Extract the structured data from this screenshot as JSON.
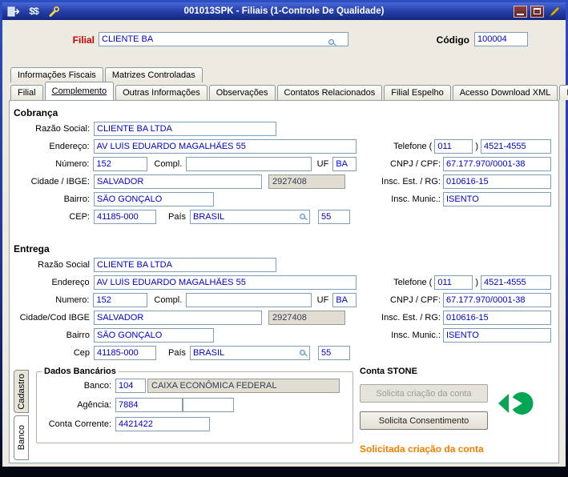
{
  "window": {
    "title": "001013SPK - Filiais (1-Controle De Qualidade)",
    "icons_left": [
      "exit-icon",
      "money-icon",
      "wrench-icon"
    ],
    "money_glyph": "$$",
    "icons_right": [
      "minimize-icon",
      "maximize-icon",
      "edit-pencil-icon"
    ]
  },
  "colors": {
    "filial_label": "#cc0000",
    "status_orange": "#ef7f00",
    "stone_green": "#00a651",
    "input_text": "#0000cc",
    "titlebar_blue": "#2743ae"
  },
  "header": {
    "filial_label": "Filial",
    "filial_value": "CLIENTE BA",
    "codigo_label": "Código",
    "codigo_value": "100004"
  },
  "tabs_top": [
    {
      "label": "Informações Fiscais"
    },
    {
      "label": "Matrizes Controladas"
    }
  ],
  "tabs_main": [
    {
      "label": "Filial"
    },
    {
      "label": "Complemento",
      "active": true
    },
    {
      "label": "Outras Informações"
    },
    {
      "label": "Observações"
    },
    {
      "label": "Contatos Relacionados"
    },
    {
      "label": "Filial Espelho"
    },
    {
      "label": "Acesso Download XML"
    },
    {
      "label": "Log"
    }
  ],
  "cobranca": {
    "title": "Cobrança",
    "labels": {
      "razao": "Razão Social:",
      "endereco": "Endereço:",
      "numero": "Número:",
      "compl": "Compl.",
      "uf": "UF",
      "cidade": "Cidade / IBGE:",
      "bairro": "Bairro:",
      "cep": "CEP:",
      "pais": "País",
      "telefone": "Telefone",
      "paren_open": "(",
      "paren_close": ")",
      "cnpj": "CNPJ / CPF:",
      "insc_est": "Insc. Est. / RG:",
      "insc_mun": "Insc. Munic.:"
    },
    "values": {
      "razao": "CLIENTE BA LTDA",
      "endereco": "AV LUÍS EDUARDO MAGALHÃES 55",
      "numero": "152",
      "compl": "",
      "uf": "BA",
      "cidade": "SALVADOR",
      "ibge": "2927408",
      "bairro": "SÃO GONÇALO",
      "cep": "41185-000",
      "pais": "BRASIL",
      "ddi": "55",
      "ddd": "011",
      "telefone": "4521-4555",
      "cnpj": "67.177.970/0001-38",
      "insc_est": "010616-15",
      "insc_mun": "ISENTO"
    }
  },
  "entrega": {
    "title": "Entrega",
    "labels": {
      "razao": "Razão Social",
      "endereco": "Endereço",
      "numero": "Numero:",
      "compl": "Compl.",
      "uf": "UF",
      "cidade": "Cidade/Cod IBGE",
      "bairro": "Bairro",
      "cep": "Cep",
      "pais": "País",
      "telefone": "Telefone",
      "paren_open": "(",
      "paren_close": ")",
      "cnpj": "CNPJ / CPF:",
      "insc_est": "Insc. Est. / RG:",
      "insc_mun": "Insc. Munic.:"
    },
    "values": {
      "razao": "CLIENTE BA LTDA",
      "endereco": "AV LUÍS EDUARDO MAGALHÃES 55",
      "numero": "152",
      "compl": "",
      "uf": "BA",
      "cidade": "SALVADOR",
      "ibge": "2927408",
      "bairro": "SÃO GONÇALO",
      "cep": "41185-000",
      "pais": "BRASIL",
      "ddi": "55",
      "ddd": "011",
      "telefone": "4521-4555",
      "cnpj": "67.177.970/0001-38",
      "insc_est": "010616-15",
      "insc_mun": "ISENTO"
    }
  },
  "bottom": {
    "vtabs": [
      {
        "label": "Cadastro"
      },
      {
        "label": "Banco",
        "active": true
      }
    ],
    "dados_bancarios": {
      "title": "Dados Bancários",
      "banco_label": "Banco:",
      "banco_codigo": "104",
      "banco_nome": "CAIXA ECONÔMICA FEDERAL",
      "agencia_label": "Agência:",
      "agencia": "7884",
      "agencia_extra": "",
      "conta_label": "Conta Corrente:",
      "conta": "4421422"
    },
    "stone": {
      "title": "Conta STONE",
      "btn_criacao": "Solicita criação da conta",
      "btn_consentimento": "Solicita Consentimento",
      "status": "Solicitada criação da conta"
    }
  }
}
